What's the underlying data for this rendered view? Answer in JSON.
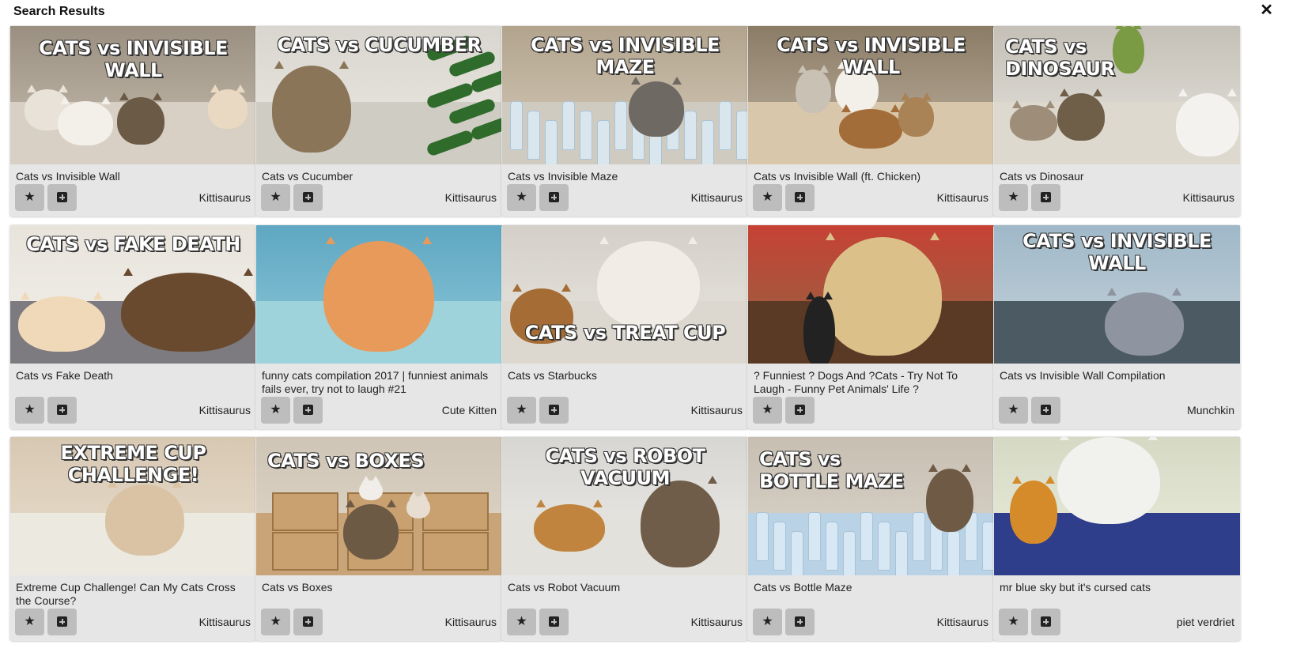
{
  "header": {
    "title": "Search Results",
    "close_glyph": "✕"
  },
  "icons": {
    "favorite": "star-icon",
    "add": "plus-square-icon",
    "close": "close-icon"
  },
  "cards": [
    {
      "title": "Cats vs Invisible Wall",
      "author": "Kittisaurus",
      "overlay": "CATS vs INVISIBLE WALL"
    },
    {
      "title": "Cats vs Cucumber",
      "author": "Kittisaurus",
      "overlay": "CATS vs CUCUMBER"
    },
    {
      "title": "Cats vs Invisible Maze",
      "author": "Kittisaurus",
      "overlay": "CATS vs INVISIBLE MAZE"
    },
    {
      "title": "Cats vs Invisible Wall (ft. Chicken)",
      "author": "Kittisaurus",
      "overlay": "CATS vs INVISIBLE WALL"
    },
    {
      "title": "Cats vs Dinosaur",
      "author": "Kittisaurus",
      "overlay": "CATS vs\nDINOSAUR"
    },
    {
      "title": "Cats vs Fake Death",
      "author": "Kittisaurus",
      "overlay": "CATS vs FAKE DEATH"
    },
    {
      "title": "funny cats compilation 2017 | funniest animals fails ever, try not to laugh #21",
      "author": "Cute Kitten",
      "overlay": ""
    },
    {
      "title": "Cats vs Starbucks",
      "author": "Kittisaurus",
      "overlay": "CATS vs TREAT CUP"
    },
    {
      "title": "? Funniest ? Dogs And ?Cats - Try Not To Laugh - Funny Pet Animals' Life ?",
      "author": "",
      "overlay": ""
    },
    {
      "title": "Cats vs Invisible Wall Compilation",
      "author": "Munchkin",
      "overlay": "CATS vs INVISIBLE WALL"
    },
    {
      "title": "Extreme Cup Challenge! Can My Cats Cross the Course?",
      "author": "Kittisaurus",
      "overlay": "EXTREME CUP CHALLENGE!"
    },
    {
      "title": "Cats vs Boxes",
      "author": "Kittisaurus",
      "overlay": "CATS vs BOXES"
    },
    {
      "title": "Cats vs Robot Vacuum",
      "author": "Kittisaurus",
      "overlay": "CATS vs ROBOT VACUUM"
    },
    {
      "title": "Cats vs Bottle Maze",
      "author": "Kittisaurus",
      "overlay": "CATS vs\nBOTTLE MAZE"
    },
    {
      "title": "mr blue sky but it's cursed cats",
      "author": "piet verdriet",
      "overlay": ""
    }
  ],
  "colors": {
    "card_bg": "#e6e6e6",
    "button_bg": "#bdbdbd"
  }
}
